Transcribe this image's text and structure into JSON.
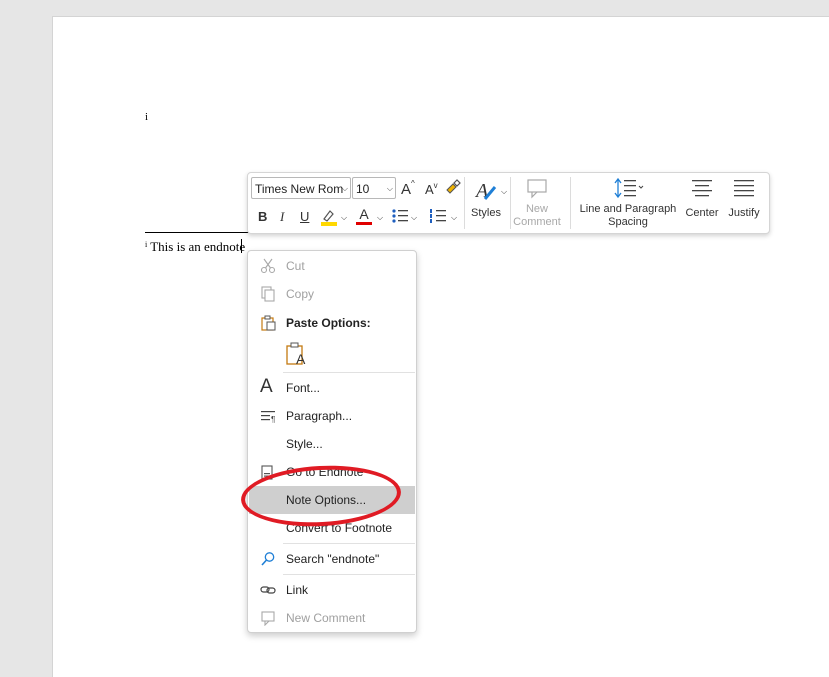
{
  "document": {
    "ref_mark": "i",
    "endnote_mark": "i",
    "endnote_text": "This is an endnote"
  },
  "toolbar": {
    "font_name": "Times New Rom",
    "font_size": "10",
    "styles_label": "Styles",
    "new_comment_label_1": "New",
    "new_comment_label_2": "Comment",
    "line_spacing_label_1": "Line and Paragraph",
    "line_spacing_label_2": "Spacing",
    "center_label": "Center",
    "justify_label": "Justify",
    "bold": "B",
    "italic": "I",
    "underline": "U",
    "grow_font": "A",
    "shrink_font": "A",
    "font_color_glyph": "A",
    "highlight_color": "#ffd800",
    "font_color": "#e00000"
  },
  "context_menu": {
    "items": [
      {
        "label": "Cut",
        "icon": "scissors-icon",
        "enabled": false
      },
      {
        "label": "Copy",
        "icon": "copy-icon",
        "enabled": false
      },
      {
        "label": "Paste Options:",
        "icon": "paste-icon",
        "enabled": true
      },
      {
        "label": "Font...",
        "icon": "font-icon",
        "enabled": true
      },
      {
        "label": "Paragraph...",
        "icon": "paragraph-icon",
        "enabled": true
      },
      {
        "label": "Style...",
        "icon": "",
        "enabled": true
      },
      {
        "label": "Go to Endnote",
        "icon": "go-to-note-icon",
        "enabled": true
      },
      {
        "label": "Note Options...",
        "icon": "",
        "enabled": true,
        "highlighted": true
      },
      {
        "label": "Convert to Footnote",
        "icon": "",
        "enabled": true
      },
      {
        "label": "Search \"endnote\"",
        "icon": "search-icon",
        "enabled": true
      },
      {
        "label": "Link",
        "icon": "link-icon",
        "enabled": true
      },
      {
        "label": "New Comment",
        "icon": "new-comment-icon",
        "enabled": false
      }
    ],
    "paste_keep_text_glyph": "A"
  },
  "annotation": {
    "color": "#e01b24"
  }
}
